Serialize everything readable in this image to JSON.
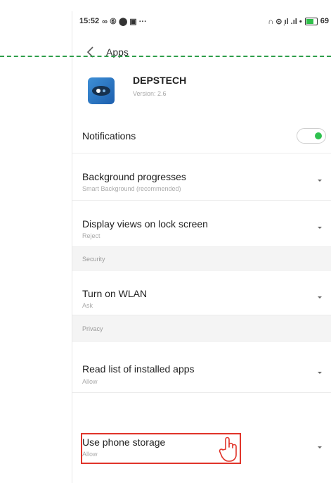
{
  "status_bar": {
    "time": "15:52",
    "left_icons": "∞ ⑥ ⬤ ▣ ···",
    "right_icons": "∩ ⊙ ᷊ıl .ıl •",
    "battery": "69"
  },
  "nav": {
    "back_icon": "back-chevron-icon",
    "title": "Apps"
  },
  "app": {
    "name": "DEPSTECH",
    "version": "Version: 2.6",
    "icon": "depstech-app-icon"
  },
  "settings": {
    "notifications": {
      "title": "Notifications",
      "enabled": true,
      "toggle_color": "#2ec14f"
    },
    "background": {
      "title": "Background progresses",
      "value": "Smart Background (recommended)"
    },
    "lock_screen": {
      "title": "Display views on lock screen",
      "value": "Reject"
    },
    "security_header": "Security",
    "wlan": {
      "title": "Turn on WLAN",
      "value": "Ask"
    },
    "privacy_header": "Privacy",
    "installed_apps": {
      "title": "Read list of installed apps",
      "value": "Allow"
    },
    "storage": {
      "title": "Use phone storage",
      "value": "Allow"
    }
  },
  "annotation": {
    "highlight_color": "#e0342a",
    "guide_line_color": "#2e9e4a",
    "pointer_icon": "hand-pointer-icon"
  }
}
